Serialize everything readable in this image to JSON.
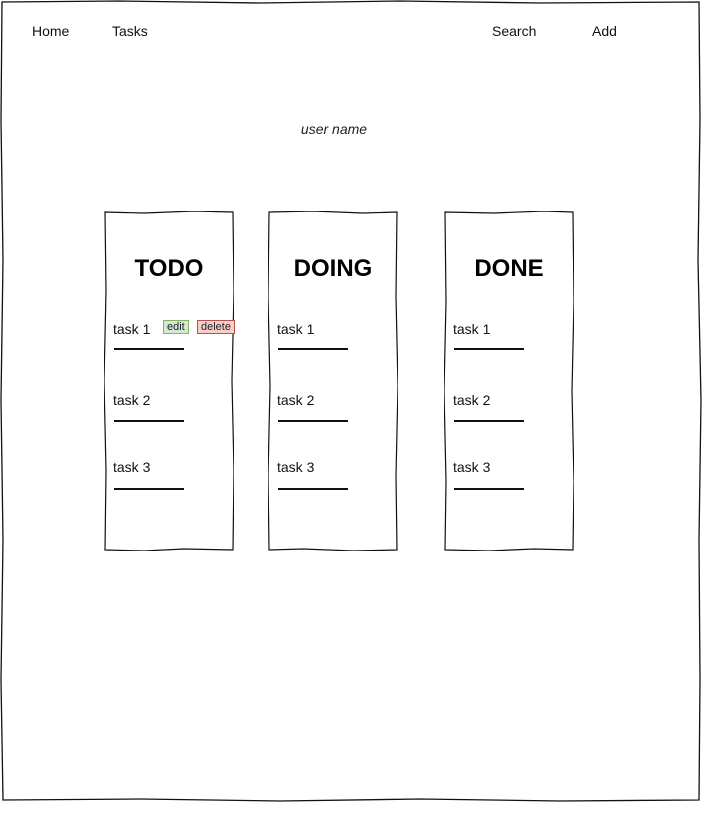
{
  "nav": {
    "home": "Home",
    "tasks": "Tasks",
    "search": "Search",
    "add": "Add"
  },
  "user": {
    "name": "user name"
  },
  "columns": [
    {
      "title": "TODO",
      "tasks": [
        "task 1",
        "task 2",
        "task 3"
      ]
    },
    {
      "title": "DOING",
      "tasks": [
        "task 1",
        "task 2",
        "task 3"
      ]
    },
    {
      "title": "DONE",
      "tasks": [
        "task 1",
        "task 2",
        "task 3"
      ]
    }
  ],
  "task_actions": {
    "edit": "edit",
    "delete": "delete"
  },
  "colors": {
    "edit_fill": "#d5e8d4",
    "edit_border": "#82b366",
    "delete_fill": "#f8cecc",
    "delete_border": "#b85450"
  }
}
